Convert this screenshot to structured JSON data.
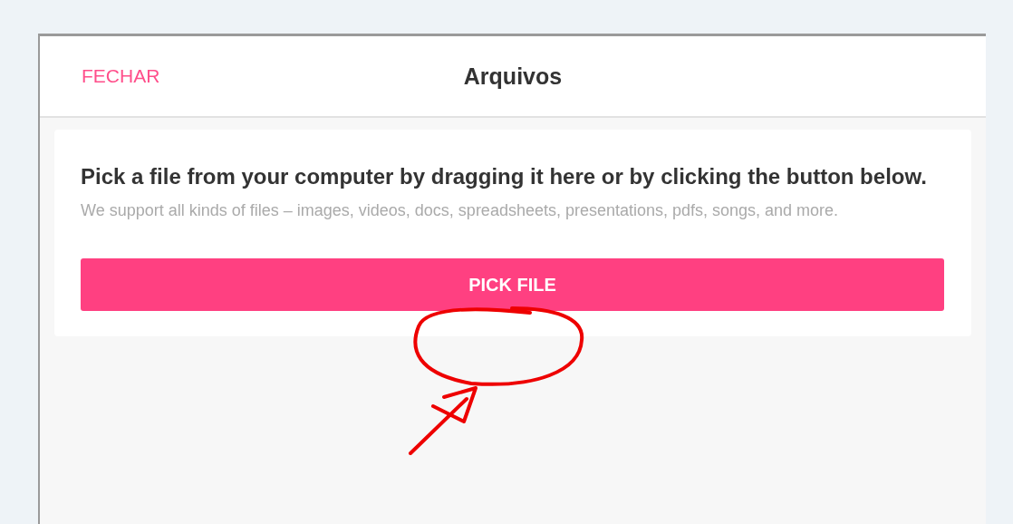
{
  "dialog": {
    "close_label": "FECHAR",
    "title": "Arquivos"
  },
  "upload_card": {
    "heading": "Pick a file from your computer by dragging it here or by clicking the button below.",
    "description": "We support all kinds of files – images, videos, docs, spreadsheets, presentations, pdfs, songs, and more.",
    "button": "PICK FILE"
  }
}
